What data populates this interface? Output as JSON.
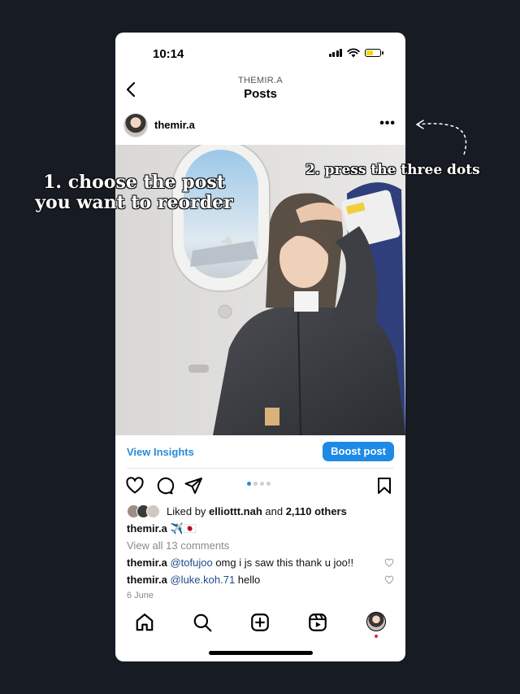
{
  "status_bar": {
    "time": "10:14",
    "battery_level": 0.55
  },
  "nav": {
    "account": "THEMIR.A",
    "title": "Posts"
  },
  "post": {
    "username": "themir.a",
    "view_insights": "View Insights",
    "boost_label": "Boost post",
    "carousel": {
      "count": 4,
      "active_index": 0
    },
    "likes": {
      "prefix": "Liked by ",
      "first_liker": "elliottt.nah",
      "middle": " and ",
      "others": "2,110 others"
    },
    "caption": {
      "user": "themir.a",
      "text": "✈️🇯🇵"
    },
    "view_all_comments": "View all 13 comments",
    "comments": [
      {
        "user": "themir.a",
        "mention": "@tofujoo",
        "text": " omg i js saw this thank u joo!!"
      },
      {
        "user": "themir.a",
        "mention": "@luke.koh.71",
        "text": " hello"
      }
    ],
    "date": "6 June"
  },
  "annotations": {
    "step1": "1. choose the post you want to reorder",
    "step2": "2. press the three dots"
  },
  "icons": {
    "status": [
      "signal-icon",
      "wifi-icon",
      "battery-icon"
    ],
    "actions": [
      "heart-icon",
      "comment-icon",
      "share-icon",
      "bookmark-icon"
    ],
    "tabs": [
      "home-icon",
      "search-icon",
      "create-icon",
      "reels-icon",
      "profile-avatar"
    ]
  },
  "colors": {
    "accent_blue": "#1d8ae6",
    "battery_yellow": "#f5d90a",
    "background": "#171b24",
    "notification_dot": "#e0224a"
  }
}
